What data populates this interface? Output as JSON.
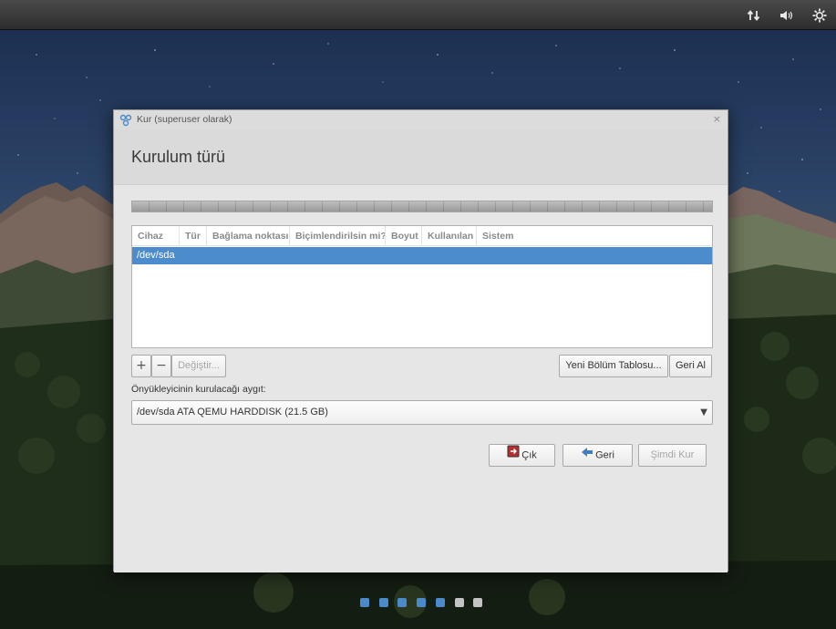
{
  "tray": {
    "network_icon": "network-transfer-icon",
    "volume_icon": "volume-icon",
    "settings_icon": "gear-icon"
  },
  "window": {
    "title": "Kur (superuser olarak)",
    "close_glyph": "×",
    "heading": "Kurulum türü"
  },
  "table": {
    "columns": [
      "Cihaz",
      "Tür",
      "Bağlama noktası",
      "Biçimlendirilsin mi?",
      "Boyut",
      "Kullanılan",
      "Sistem"
    ],
    "rows": [
      {
        "device": "/dev/sda",
        "selected": true
      }
    ]
  },
  "partition_buttons": {
    "add": "+",
    "remove": "−",
    "change": "Değiştir...",
    "new_table": "Yeni Bölüm Tablosu...",
    "revert": "Geri Al"
  },
  "bootloader": {
    "label": "Önyükleyicinin kurulacağı aygıt:",
    "selected": "/dev/sda ATA QEMU HARDDISK (21.5 GB)"
  },
  "nav_buttons": {
    "quit": "Çık",
    "back": "Geri",
    "install": "Şimdi Kur"
  },
  "progress": {
    "total_steps": 7,
    "completed_steps": 5,
    "active_color": "#4a8ac8",
    "inactive_color": "#c3c3c3"
  },
  "colors": {
    "selection": "#4c8ccc",
    "panel": "#2d2d2d"
  }
}
